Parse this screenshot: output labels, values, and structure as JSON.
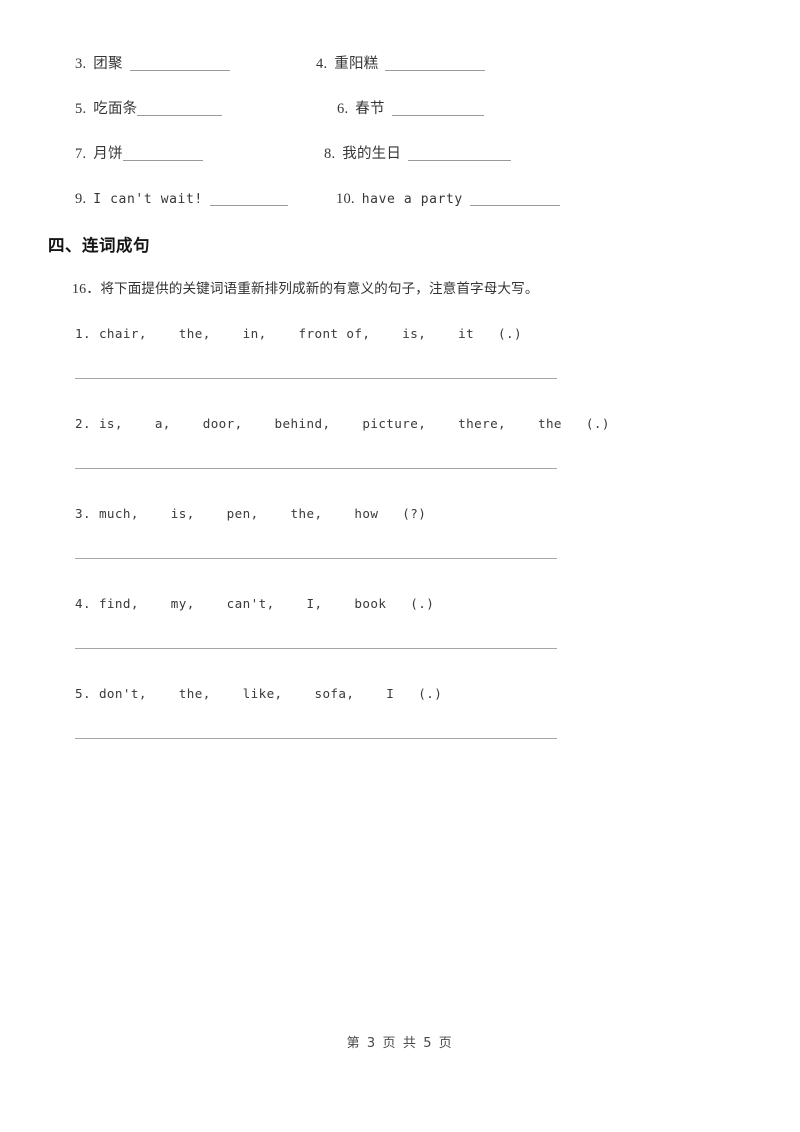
{
  "document": {
    "background_color": "#ffffff",
    "text_color": "#333333",
    "rule_color": "#a6a6a6"
  },
  "fill_in_blanks": {
    "rows": [
      {
        "left": {
          "number": "3.",
          "prompt": "团聚",
          "script": "zh",
          "blank_width": 100
        },
        "right": {
          "number": "4.",
          "prompt": "重阳糕",
          "script": "zh",
          "blank_width": 100
        }
      },
      {
        "left": {
          "number": "5.",
          "prompt": "吃面条",
          "script": "zh",
          "blank_width": 85
        },
        "right": {
          "number": "6.",
          "prompt": "春节",
          "script": "zh",
          "blank_width": 92
        }
      },
      {
        "left": {
          "number": "7.",
          "prompt": "月饼",
          "script": "zh",
          "blank_width": 80
        },
        "right": {
          "number": "8.",
          "prompt": "我的生日",
          "script": "zh",
          "blank_width": 103
        }
      },
      {
        "left": {
          "number": "9.",
          "prompt": "I can't wait!",
          "script": "en",
          "blank_width": 78
        },
        "right": {
          "number": "10.",
          "prompt": "have a party",
          "script": "en",
          "blank_width": 90
        }
      }
    ]
  },
  "section": {
    "heading": "四、连词成句",
    "instruction_index": "16．",
    "instruction_text": "将下面提供的关键词语重新排列成新的有意义的句子，注意首字母大写。"
  },
  "reorder_questions": [
    {
      "number": "1.",
      "words": "chair,    the,    in,    front of,    is,    it   (.)"
    },
    {
      "number": "2.",
      "words": "is,    a,    door,    behind,    picture,    there,    the   (.)"
    },
    {
      "number": "3.",
      "words": "much,    is,    pen,    the,    how   (?)"
    },
    {
      "number": "4.",
      "words": "find,    my,    can't,    I,    book   (.)"
    },
    {
      "number": "5.",
      "words": "don't,    the,    like,    sofa,    I   (.)"
    }
  ],
  "footer": {
    "text": "第 3 页 共 5 页",
    "current_page": "3",
    "total_pages": "5"
  }
}
